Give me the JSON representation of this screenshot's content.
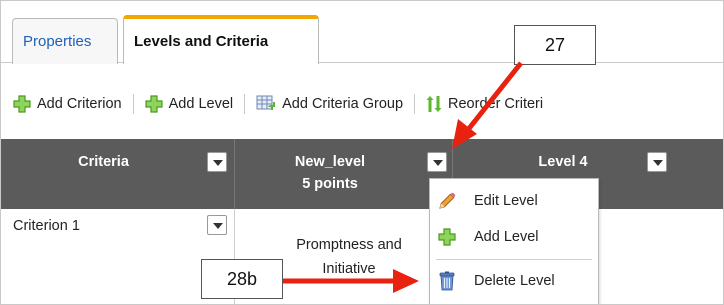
{
  "tabs": [
    {
      "label": "Properties",
      "active": false
    },
    {
      "label": "Levels and Criteria",
      "active": true
    }
  ],
  "toolbar": {
    "add_criterion": "Add Criterion",
    "add_level": "Add Level",
    "add_criteria_group": "Add Criteria Group",
    "reorder_criteria": "Reorder Criteri"
  },
  "grid": {
    "columns": [
      {
        "title": "Criteria"
      },
      {
        "title": "New_level",
        "points": "5 points"
      },
      {
        "title": "Level 4"
      }
    ],
    "rows": [
      {
        "criterion": "Criterion 1",
        "new_level_text": "Promptness and Initiative"
      }
    ]
  },
  "menu": {
    "items": [
      {
        "label": "Edit Level",
        "icon": "pencil-icon"
      },
      {
        "label": "Add Level",
        "icon": "plus-icon"
      },
      {
        "label": "Delete Level",
        "icon": "trash-icon"
      }
    ]
  },
  "annotations": {
    "callout_27": "27",
    "callout_28b": "28b"
  },
  "colors": {
    "header_bg": "#5b5b5b",
    "active_tab_accent": "#f0a800",
    "link_blue": "#2060b8",
    "arrow_red": "#e8220f",
    "plus_green": "#5cb82e"
  }
}
